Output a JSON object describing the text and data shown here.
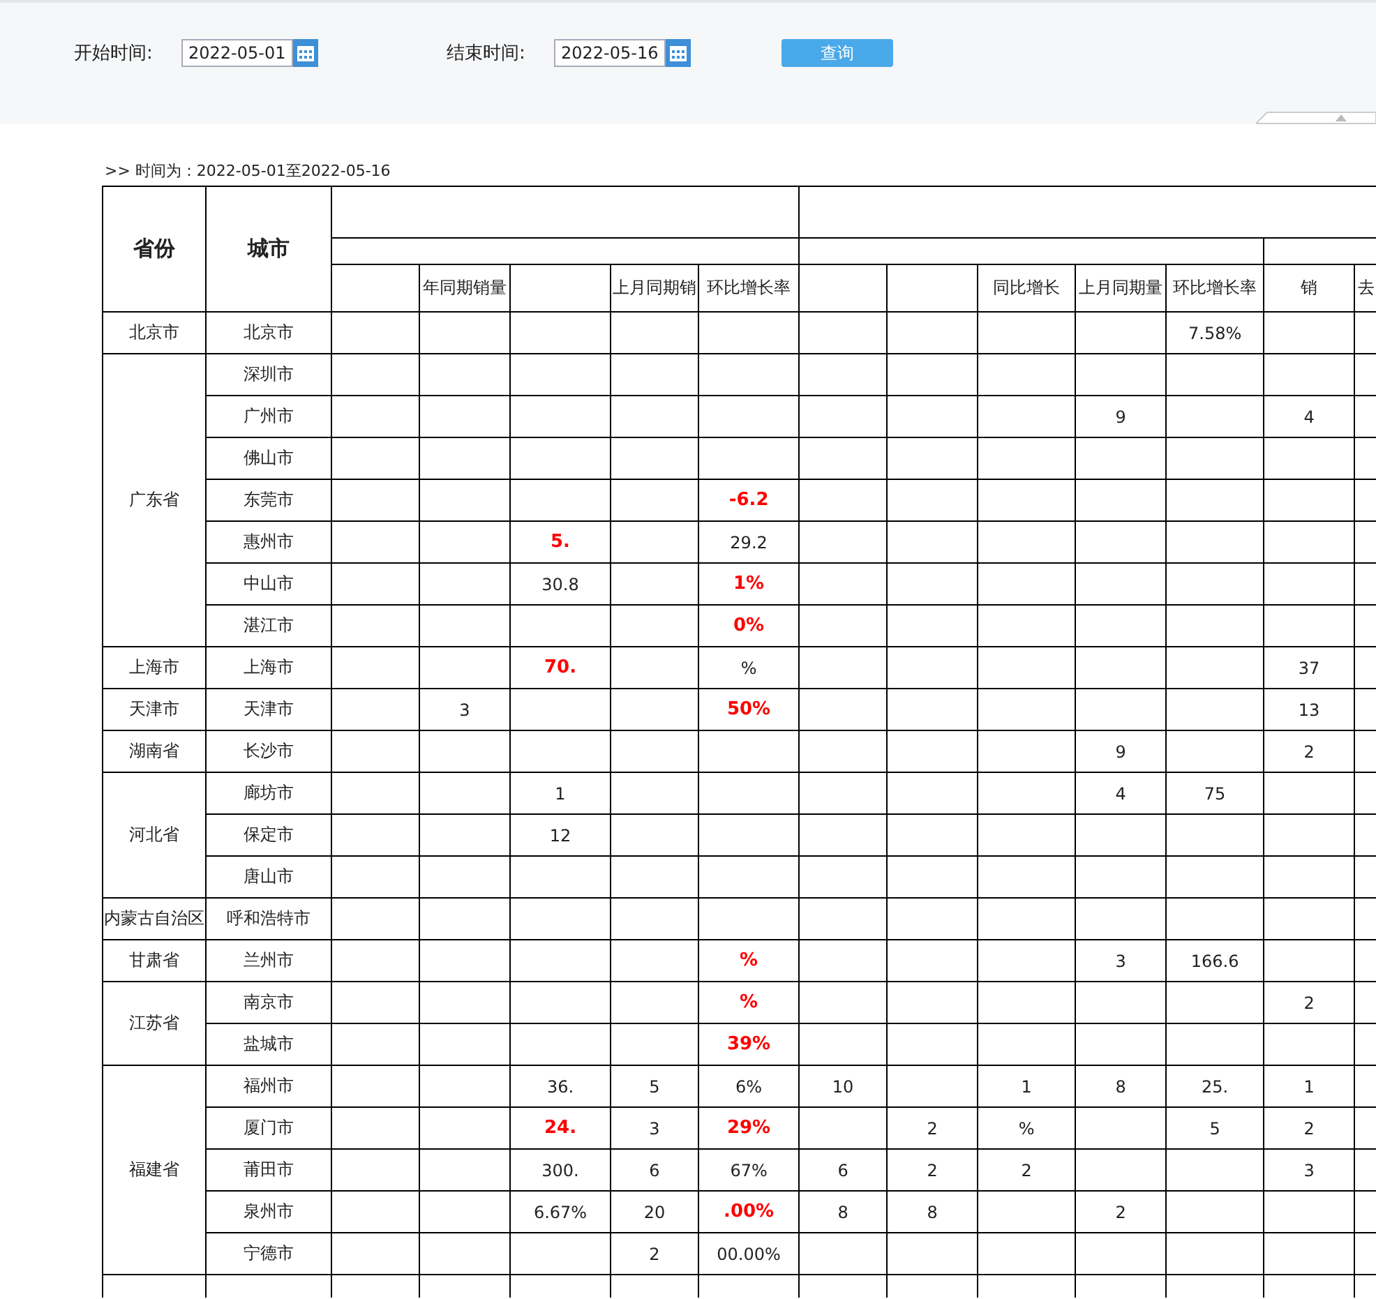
{
  "filters": [
    {
      "label": "开始时间:",
      "value": "2022-05-01"
    },
    {
      "label": "结束时间:",
      "value": "2022-05-16"
    }
  ],
  "query_button": "查询",
  "range_text": ">> 时间为：2022-05-01至2022-05-16",
  "table": {
    "province_header": "省份",
    "city_header": "城市",
    "column_headers": {
      "column_4": "年同期销量",
      "column_6": "上月同期销",
      "column_7": "环比增长率",
      "column_10": "同比增长",
      "column_11": "上月同期量",
      "column_12": "环比增长率",
      "column_13": "销",
      "column_14": "去"
    },
    "groups": [
      {
        "province": "北京市",
        "cities": [
          {
            "city": "北京市",
            "cells": [
              null,
              null,
              null,
              null,
              null,
              null,
              null,
              null,
              null,
              {
                "text": "7.58%",
                "red": false
              },
              null,
              null
            ]
          }
        ]
      },
      {
        "province": "广东省",
        "cities": [
          {
            "city": "深圳市",
            "cells": [
              null,
              null,
              null,
              null,
              null,
              null,
              null,
              null,
              null,
              null,
              null,
              null
            ]
          },
          {
            "city": "广州市",
            "cells": [
              null,
              null,
              null,
              null,
              null,
              null,
              null,
              null,
              {
                "text": "9",
                "red": false
              },
              null,
              {
                "text": "4",
                "red": false
              },
              null
            ]
          },
          {
            "city": "佛山市",
            "cells": [
              null,
              null,
              null,
              null,
              null,
              null,
              null,
              null,
              null,
              null,
              null,
              null
            ]
          },
          {
            "city": "东莞市",
            "cells": [
              null,
              null,
              null,
              null,
              {
                "text": "-6.2",
                "red": true
              },
              null,
              null,
              null,
              null,
              null,
              null,
              null
            ]
          },
          {
            "city": "惠州市",
            "cells": [
              null,
              null,
              {
                "text": "5.",
                "red": true
              },
              null,
              {
                "text": "29.2",
                "red": false
              },
              null,
              null,
              null,
              null,
              null,
              null,
              null
            ]
          },
          {
            "city": "中山市",
            "cells": [
              null,
              null,
              {
                "text": "30.8",
                "red": false
              },
              null,
              {
                "text": "1%",
                "red": true
              },
              null,
              null,
              null,
              null,
              null,
              null,
              null
            ]
          },
          {
            "city": "湛江市",
            "cells": [
              null,
              null,
              null,
              null,
              {
                "text": "0%",
                "red": true
              },
              null,
              null,
              null,
              null,
              null,
              null,
              null
            ]
          }
        ]
      },
      {
        "province": "上海市",
        "cities": [
          {
            "city": "上海市",
            "cells": [
              null,
              null,
              {
                "text": "70.",
                "red": true
              },
              null,
              {
                "text": "%",
                "red": false
              },
              null,
              null,
              null,
              null,
              null,
              {
                "text": "37",
                "red": false
              },
              null
            ]
          }
        ]
      },
      {
        "province": "天津市",
        "cities": [
          {
            "city": "天津市",
            "cells": [
              null,
              {
                "text": "3",
                "red": false
              },
              null,
              null,
              {
                "text": "50%",
                "red": true
              },
              null,
              null,
              null,
              null,
              null,
              {
                "text": "13",
                "red": false
              },
              null
            ]
          }
        ]
      },
      {
        "province": "湖南省",
        "cities": [
          {
            "city": "长沙市",
            "cells": [
              null,
              null,
              null,
              null,
              null,
              null,
              null,
              null,
              {
                "text": "9",
                "red": false
              },
              null,
              {
                "text": "2",
                "red": false
              },
              null
            ]
          }
        ]
      },
      {
        "province": "河北省",
        "cities": [
          {
            "city": "廊坊市",
            "cells": [
              null,
              null,
              {
                "text": "1",
                "red": false
              },
              null,
              null,
              null,
              null,
              null,
              {
                "text": "4",
                "red": false
              },
              {
                "text": "75",
                "red": false
              },
              null,
              null
            ]
          },
          {
            "city": "保定市",
            "cells": [
              null,
              null,
              {
                "text": "12",
                "red": false
              },
              null,
              null,
              null,
              null,
              null,
              null,
              null,
              null,
              null
            ]
          },
          {
            "city": "唐山市",
            "cells": [
              null,
              null,
              null,
              null,
              null,
              null,
              null,
              null,
              null,
              null,
              null,
              null
            ]
          }
        ]
      },
      {
        "province": "内蒙古自治区",
        "cities": [
          {
            "city": "呼和浩特市",
            "cells": [
              null,
              null,
              null,
              null,
              null,
              null,
              null,
              null,
              null,
              null,
              null,
              null
            ]
          }
        ]
      },
      {
        "province": "甘肃省",
        "cities": [
          {
            "city": "兰州市",
            "cells": [
              null,
              null,
              null,
              null,
              {
                "text": "%",
                "red": true
              },
              null,
              null,
              null,
              {
                "text": "3",
                "red": false
              },
              {
                "text": "166.6",
                "red": false
              },
              null,
              null
            ]
          }
        ]
      },
      {
        "province": "江苏省",
        "cities": [
          {
            "city": "南京市",
            "cells": [
              null,
              null,
              null,
              null,
              {
                "text": "%",
                "red": true
              },
              null,
              null,
              null,
              null,
              null,
              {
                "text": "2",
                "red": false
              },
              null
            ]
          },
          {
            "city": "盐城市",
            "cells": [
              null,
              null,
              null,
              null,
              {
                "text": "39%",
                "red": true
              },
              null,
              null,
              null,
              null,
              null,
              null,
              null
            ]
          }
        ]
      },
      {
        "province": "福建省",
        "cities": [
          {
            "city": "福州市",
            "cells": [
              null,
              null,
              {
                "text": "36.",
                "red": false
              },
              {
                "text": "5",
                "red": false
              },
              {
                "text": "6%",
                "red": false
              },
              {
                "text": "10",
                "red": false
              },
              null,
              {
                "text": "1",
                "red": false
              },
              {
                "text": "8",
                "red": false
              },
              {
                "text": "25.",
                "red": false
              },
              {
                "text": "1",
                "red": false
              },
              null
            ]
          },
          {
            "city": "厦门市",
            "cells": [
              null,
              null,
              {
                "text": "24.",
                "red": true
              },
              {
                "text": "3",
                "red": false
              },
              {
                "text": "29%",
                "red": true
              },
              null,
              {
                "text": "2",
                "red": false
              },
              {
                "text": "%",
                "red": false
              },
              null,
              {
                "text": "5",
                "red": false
              },
              {
                "text": "2",
                "red": false
              },
              null
            ]
          },
          {
            "city": "莆田市",
            "cells": [
              null,
              null,
              {
                "text": "300.",
                "red": false
              },
              {
                "text": "6",
                "red": false
              },
              {
                "text": "67%",
                "red": false
              },
              {
                "text": "6",
                "red": false
              },
              {
                "text": "2",
                "red": false
              },
              {
                "text": "2",
                "red": false
              },
              null,
              null,
              {
                "text": "3",
                "red": false
              },
              null
            ]
          },
          {
            "city": "泉州市",
            "cells": [
              null,
              null,
              {
                "text": "6.67%",
                "red": false
              },
              {
                "text": "20",
                "red": false
              },
              {
                "text": ".00%",
                "red": true
              },
              {
                "text": "8",
                "red": false
              },
              {
                "text": "8",
                "red": false
              },
              null,
              {
                "text": "2",
                "red": false
              },
              null,
              null,
              null
            ]
          },
          {
            "city": "宁德市",
            "cells": [
              null,
              null,
              null,
              {
                "text": "2",
                "red": false
              },
              {
                "text": "00.00%",
                "red": false
              },
              null,
              null,
              null,
              null,
              null,
              null,
              null
            ]
          }
        ]
      }
    ]
  }
}
